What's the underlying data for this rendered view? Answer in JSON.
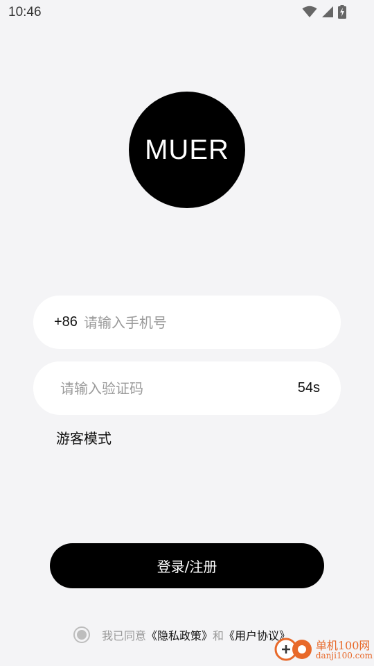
{
  "status_bar": {
    "time": "10:46"
  },
  "logo": {
    "text": "MUER"
  },
  "phone_field": {
    "country_code": "+86",
    "value": "",
    "placeholder": "请输入手机号"
  },
  "code_field": {
    "value": "",
    "placeholder": "请输入验证码",
    "countdown": "54s"
  },
  "guest_mode_label": "游客模式",
  "login_button_label": "登录/注册",
  "agreement": {
    "prefix": "我已同意",
    "privacy_link": "《隐私政策》",
    "conjunction": "和",
    "terms_link": "《用户协议》"
  },
  "watermark": {
    "title": "单机100网",
    "url": "danji100.com"
  },
  "colors": {
    "background": "#f4f4f6",
    "primary": "#000000",
    "field_background": "#ffffff",
    "placeholder": "#9a9a9a",
    "watermark": "#e8692a"
  },
  "icons": [
    "wifi-icon",
    "cell-signal-icon",
    "battery-charging-icon",
    "radio-checked-icon",
    "watermark-logo-icon"
  ]
}
